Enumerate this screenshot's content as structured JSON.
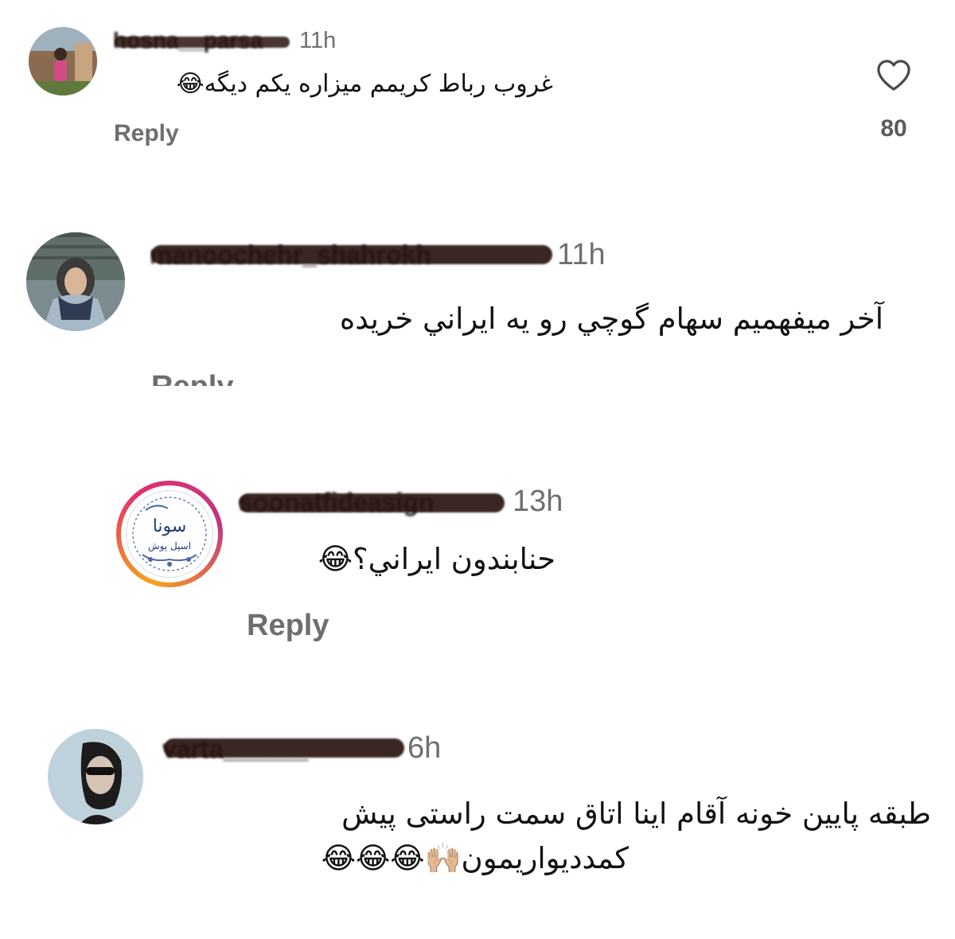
{
  "comments": [
    {
      "username": "hosna__parsa",
      "time": "11h",
      "text": "غروب رباط کریمم میزاره یکم دیگه😂",
      "reply_label": "Reply",
      "likes": "80"
    },
    {
      "username": "manoochehr_shahrokh",
      "time": "11h",
      "text": "آخر ميفهميم سهام گوچي رو يه ايراني خريده",
      "reply_label": "Reply"
    },
    {
      "username": "soonatfideasign",
      "time": "13h",
      "text": "حنابندون ايراني؟😂",
      "reply_label": "Reply",
      "avatar_logo_line1": "سونا",
      "avatar_logo_line2": "اسپل پوش"
    },
    {
      "username": "varta______",
      "time": "6h",
      "text_line1": "طبقه پایین خونه آقام اینا اتاق سمت راستی پیش",
      "text_line2": "کمددیواریمون🙌🏼😂😂😂"
    }
  ],
  "icons": {
    "like": "heart-outline-icon"
  },
  "colors": {
    "story_ring_start": "#f9a21b",
    "story_ring_mid": "#e1306c",
    "story_ring_end": "#8a2be2",
    "redaction": "#2a1410"
  }
}
